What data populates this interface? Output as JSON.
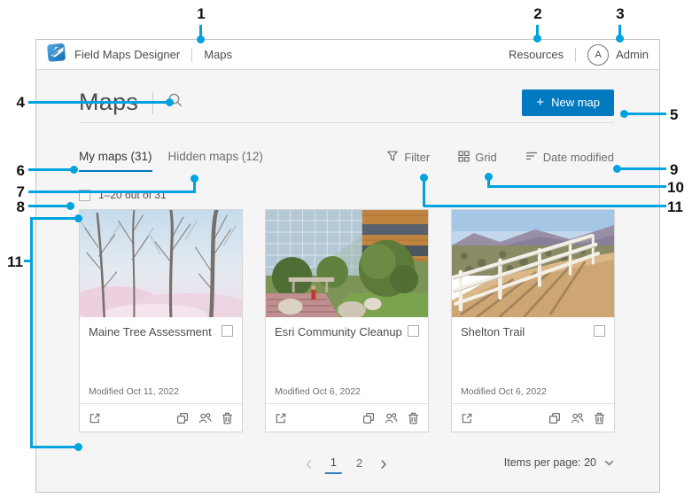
{
  "colors": {
    "accent_blue": "#0079c1",
    "callout_blue": "#00a3dd",
    "nav_text": "#4c4c4c",
    "muted_text": "#6e6e6e",
    "content_bg": "#f5f5f6"
  },
  "navbar": {
    "logo_icon": "esri-logo",
    "app_title": "Field Maps Designer",
    "nav_item_maps": "Maps",
    "resources": "Resources",
    "avatar_initial": "A",
    "user_name": "Admin"
  },
  "page_header": {
    "title": "Maps",
    "search_icon": "magnifier",
    "new_map_plus": "+",
    "new_map_label": "New map"
  },
  "tabs": {
    "my_maps": "My maps (31)",
    "hidden_maps": "Hidden maps (12)"
  },
  "toolbar": {
    "filter_label": "Filter",
    "view_label": "Grid",
    "sort_label": "Date modified"
  },
  "selection_bar": {
    "label": "1–20 out of 31"
  },
  "cards": [
    {
      "title": "Maine Tree Assessment",
      "modified": "Modified Oct 11, 2022",
      "thumbnail": "bare-winter-trees"
    },
    {
      "title": "Esri Community Cleanup",
      "modified": "Modified Oct 6, 2022",
      "thumbnail": "campus-building-garden"
    },
    {
      "title": "Shelton Trail",
      "modified": "Modified Oct 6, 2022",
      "thumbnail": "white-fence-dirt-trail"
    }
  ],
  "pagination": {
    "page1": "1",
    "page2": "2",
    "items_per_page": "Items per page: 20"
  },
  "callouts": {
    "n1": "1",
    "n2": "2",
    "n3": "3",
    "n4": "4",
    "n5": "5",
    "n6": "6",
    "n7": "7",
    "n8": "8",
    "n9": "9",
    "n10": "10",
    "n11": "11"
  }
}
